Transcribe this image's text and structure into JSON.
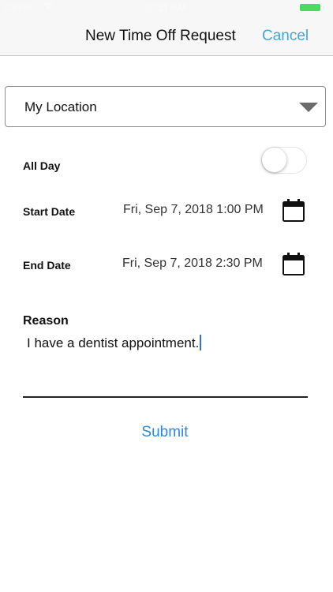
{
  "status_bar": {
    "carrier": "Carrier",
    "time": "10:11 AM",
    "battery_color": "#4cd964"
  },
  "nav": {
    "title": "New Time Off Request",
    "cancel_label": "Cancel"
  },
  "location": {
    "selected": "My Location"
  },
  "all_day": {
    "label": "All Day",
    "on": false
  },
  "start": {
    "label": "Start Date",
    "value": "Fri, Sep 7, 2018 1:00 PM",
    "icon": "calendar-icon"
  },
  "end": {
    "label": "End Date",
    "value": "Fri, Sep 7, 2018 2:30 PM",
    "icon": "calendar-icon"
  },
  "reason": {
    "label": "Reason",
    "value": "I have a dentist appointment."
  },
  "submit_label": "Submit",
  "colors": {
    "accent": "#43a6d8",
    "submit": "#2a8adf",
    "cursor": "#3b6fe0"
  }
}
